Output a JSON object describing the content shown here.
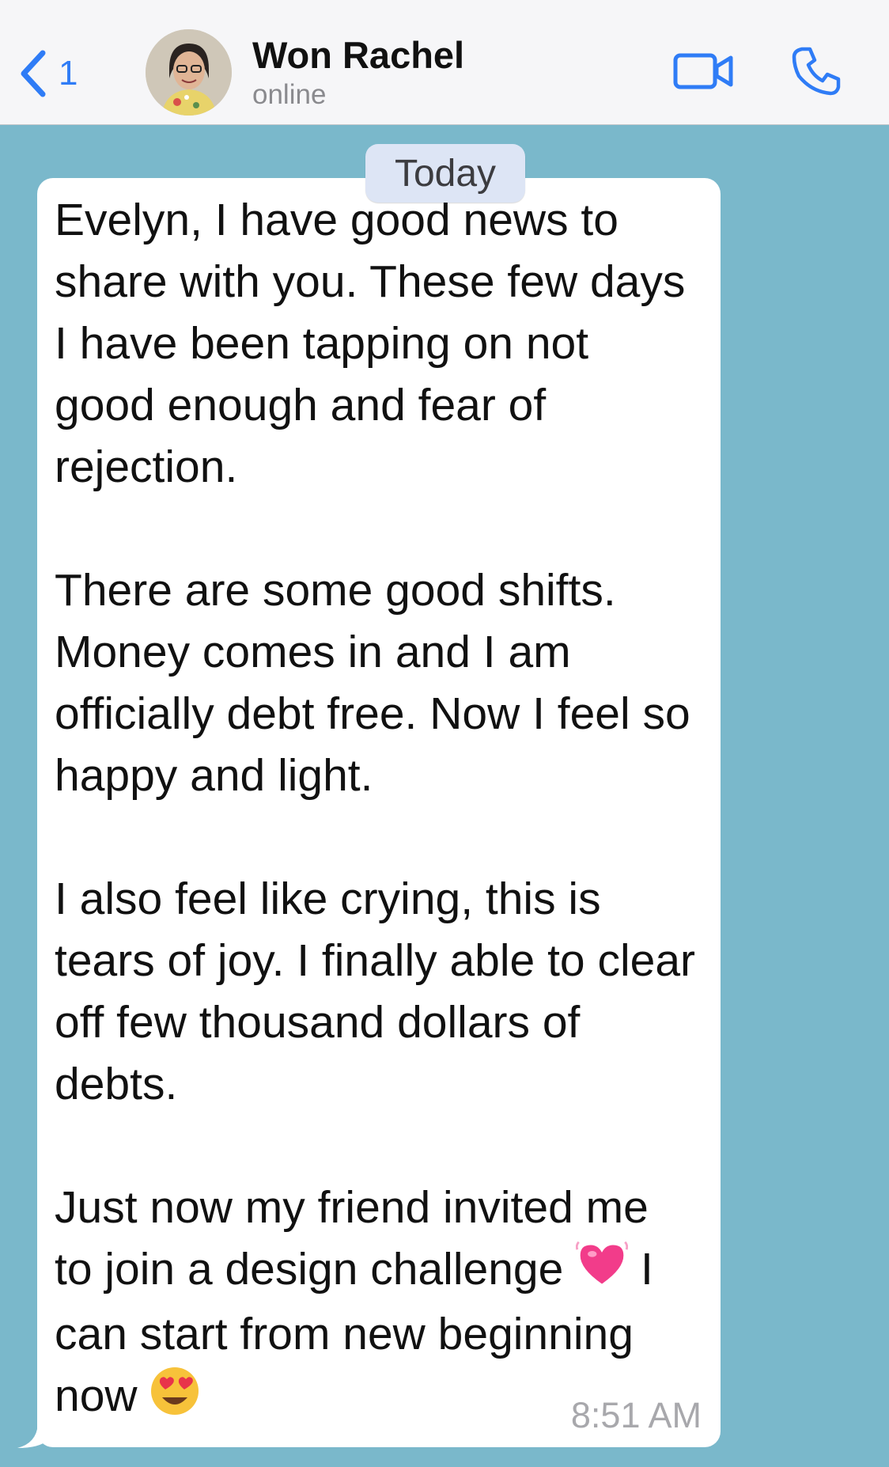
{
  "header": {
    "back_count": "1",
    "contact_name": "Won Rachel",
    "contact_status": "online"
  },
  "date_label": "Today",
  "message": {
    "paragraphs": [
      "Evelyn, I have good news to share with you. These few days I have been tapping on not good enough and fear of rejection.",
      "There are some good shifts. Money comes in and I am officially debt free. Now I feel so happy and light.",
      "I also feel like crying, this is tears of joy. I finally able to clear off few thousand dollars of debts."
    ],
    "last_paragraph": {
      "before_emoji": "Just now my friend invited me to join a design challenge",
      "after_emoji": "I can start from new beginning now"
    },
    "time": "8:51 AM"
  },
  "icons": {
    "back": "chevron-left-icon",
    "video": "video-camera-icon",
    "phone": "phone-icon",
    "emoji_1": "heart-emoji",
    "emoji_2": "heart-eyes-emoji"
  },
  "colors": {
    "accent": "#2f7cf6",
    "chat_background": "#7ab8cb",
    "date_pill": "#dde5f5"
  }
}
